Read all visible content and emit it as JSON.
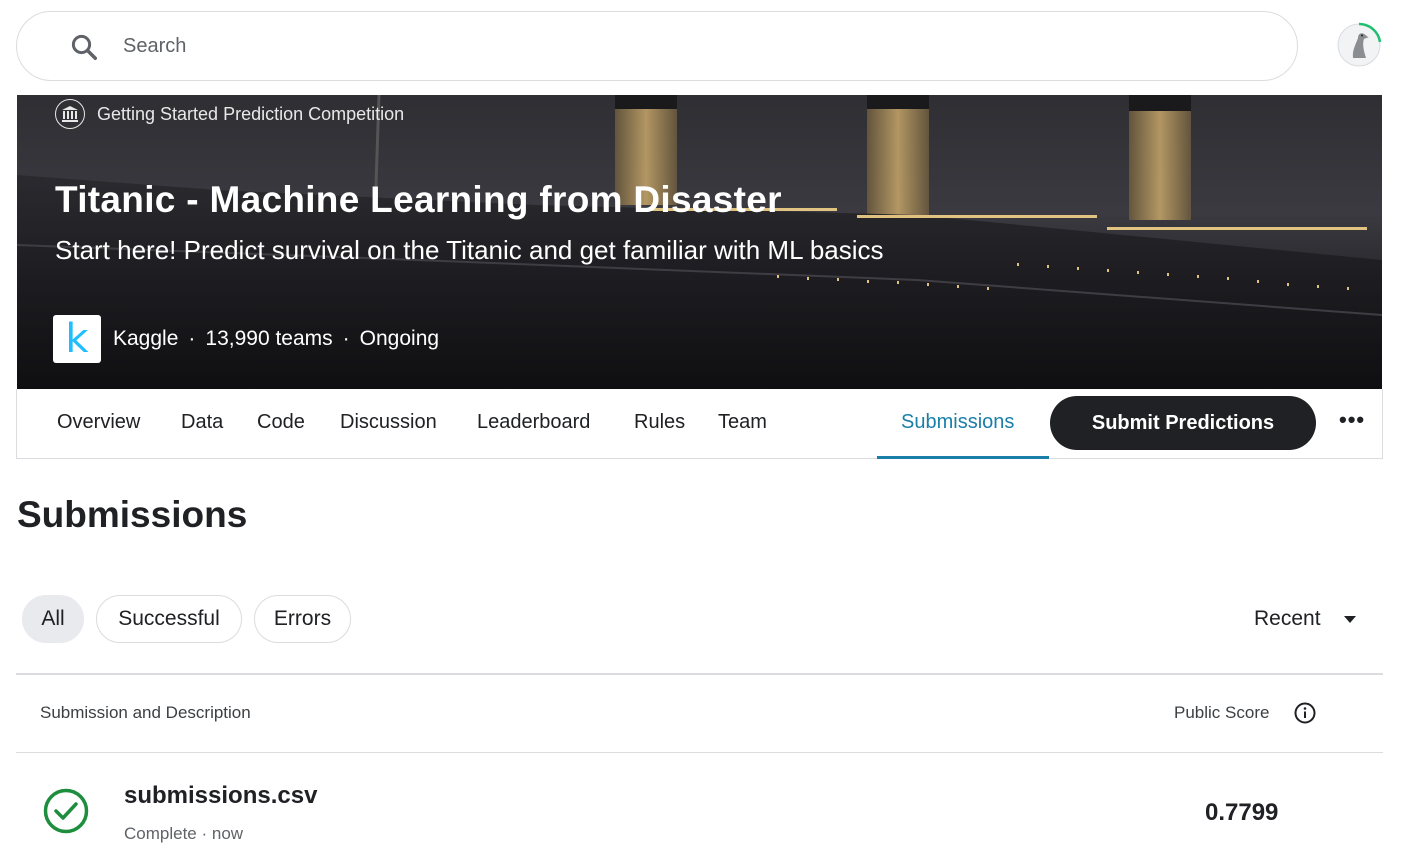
{
  "search": {
    "placeholder": "Search"
  },
  "banner": {
    "competition_type": "Getting Started Prediction Competition",
    "title": "Titanic - Machine Learning from Disaster",
    "subtitle": "Start here! Predict survival on the Titanic and get familiar with ML basics",
    "host_logo_letter": "k",
    "host": "Kaggle",
    "teams": "13,990 teams",
    "status": "Ongoing",
    "separator": "·"
  },
  "tabs": [
    {
      "label": "Overview"
    },
    {
      "label": "Data"
    },
    {
      "label": "Code"
    },
    {
      "label": "Discussion"
    },
    {
      "label": "Leaderboard"
    },
    {
      "label": "Rules"
    },
    {
      "label": "Team"
    },
    {
      "label": "Submissions",
      "active": true
    }
  ],
  "actions": {
    "submit_label": "Submit Predictions",
    "more_label": "•••"
  },
  "page": {
    "title": "Submissions"
  },
  "filters": {
    "chips": [
      {
        "label": "All",
        "selected": true
      },
      {
        "label": "Successful",
        "selected": false
      },
      {
        "label": "Errors",
        "selected": false
      }
    ],
    "sort_label": "Recent"
  },
  "table": {
    "headers": {
      "description": "Submission and Description",
      "score": "Public Score"
    },
    "rows": [
      {
        "name": "submissions.csv",
        "status": "Complete · now",
        "public_score": "0.7799",
        "state": "success"
      }
    ]
  },
  "colors": {
    "accent": "#1a7fa8",
    "success": "#1e8e3e",
    "kaggle_blue": "#20beff",
    "dark_button": "#202124"
  },
  "icons": {
    "search": "search-icon",
    "avatar": "goose-avatar-icon",
    "badge": "institution-icon",
    "info": "info-icon",
    "check": "check-circle-icon",
    "caret": "caret-down-icon"
  }
}
